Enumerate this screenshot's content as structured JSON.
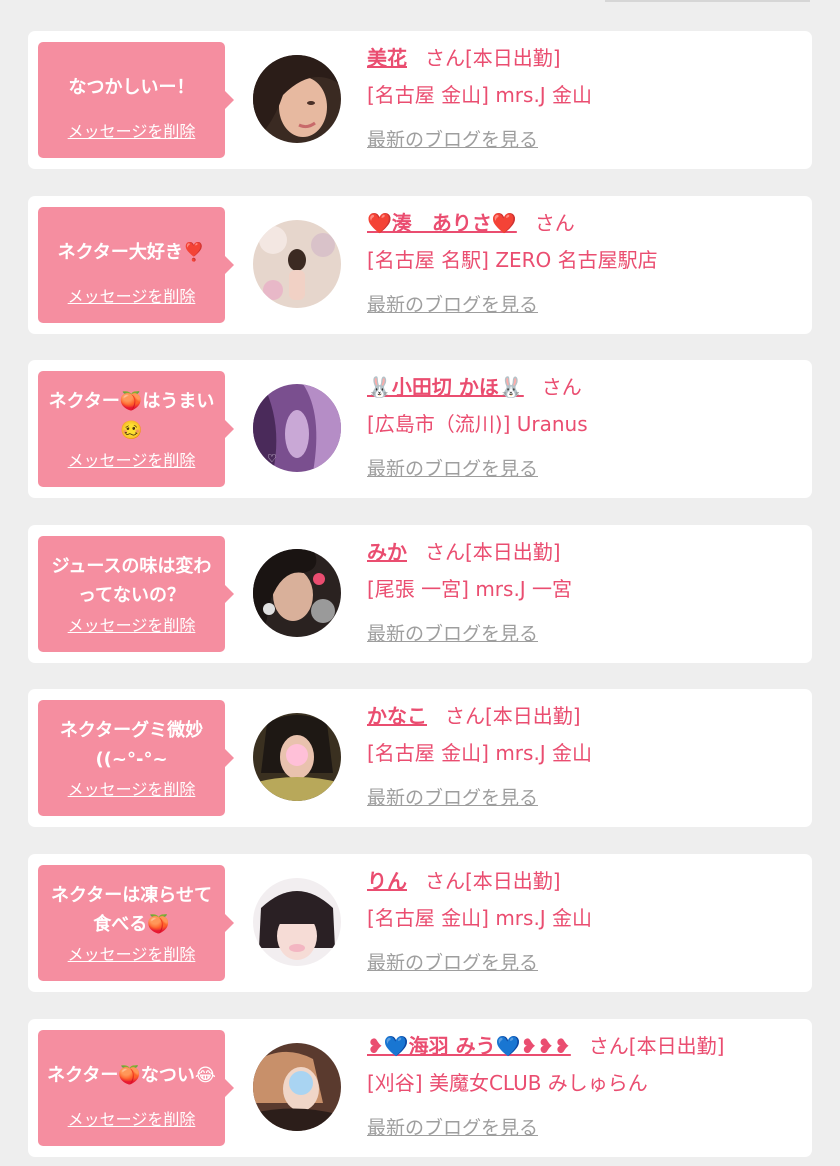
{
  "delete_label": "メッセージを削除",
  "blog_label": "最新のブログを見る",
  "colors": {
    "page_bg": "#eeeeee",
    "card_bg": "#ffffff",
    "bubble": "#f58ea0",
    "name_pink": "#ea4d70",
    "link_gray": "#9e9e9e"
  },
  "messages": [
    {
      "comment": "なつかしいー！",
      "name": "美花",
      "suffix": "さん[本日出勤]",
      "shop": "[名古屋 金山] mrs.J 金山"
    },
    {
      "comment": "ネクター大好き❣️",
      "name": "❤️湊　ありさ❤️",
      "suffix": "さん",
      "shop": "[名古屋 名駅] ZERO 名古屋駅店"
    },
    {
      "comment": "ネクター🍑はうまい🥴",
      "name": "🐰小田切 かほ🐰",
      "suffix": "さん",
      "shop": "[広島市（流川)] Uranus"
    },
    {
      "comment": "ジュースの味は変わってないの？",
      "name": "みか",
      "suffix": "さん[本日出勤]",
      "shop": "[尾張 一宮] mrs.J 一宮"
    },
    {
      "comment": "ネクターグミ微妙((~°-°~",
      "name": "かなこ",
      "suffix": "さん[本日出勤]",
      "shop": "[名古屋 金山] mrs.J 金山"
    },
    {
      "comment": "ネクターは凍らせて食べる🍑",
      "name": "りん",
      "suffix": "さん[本日出勤]",
      "shop": "[名古屋 金山] mrs.J 金山"
    },
    {
      "comment": "ネクター🍑なつい😂",
      "name": "❥💙海羽 みう💙❥❥❥",
      "suffix": "さん[本日出勤]",
      "shop": "[刈谷] 美魔女CLUB みしゅらん"
    }
  ]
}
